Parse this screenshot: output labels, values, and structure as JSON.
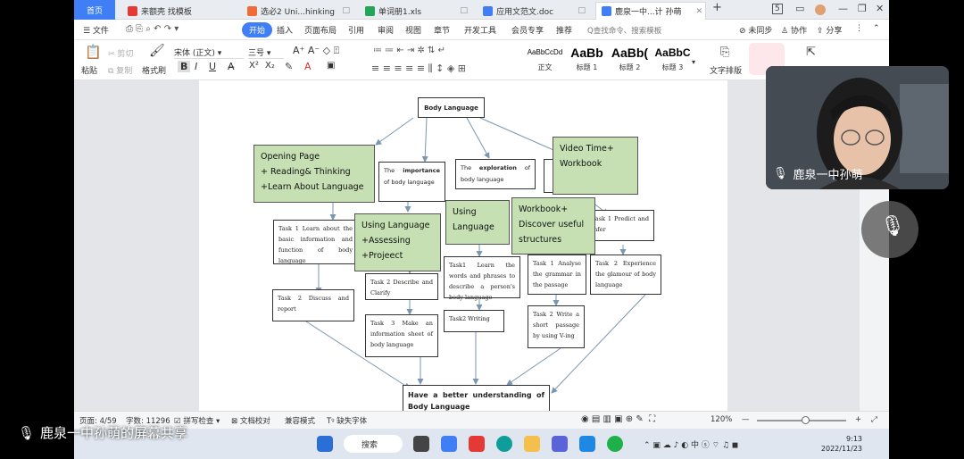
{
  "tabs": [
    {
      "label": "首页",
      "type": "home"
    },
    {
      "label": "来额壳 找模板",
      "color": "#e53935"
    },
    {
      "label": "选必2 Uni...hinking",
      "color": "#ef6c3a"
    },
    {
      "label": "单词册1.xls",
      "color": "#23a55a"
    },
    {
      "label": "应用文范文.doc",
      "color": "#3f7ef5"
    },
    {
      "label": "鹿泉一中...计 孙萌",
      "color": "#3f7ef5",
      "active": true
    }
  ],
  "window_controls": {
    "num": "5",
    "min": "—",
    "restore": "❐",
    "close": "✕"
  },
  "menu": {
    "file": "☰ 文件",
    "items": [
      "开始",
      "插入",
      "页面布局",
      "引用",
      "审阅",
      "视图",
      "章节",
      "开发工具",
      "会员专享",
      "推荐"
    ],
    "search_placeholder": "Q查找命令、搜索模板",
    "unsynced": "未同步",
    "collab": "协作",
    "share": "分享"
  },
  "ribbon": {
    "paste": "粘贴",
    "cut": "剪切",
    "copy": "复制",
    "format_painter": "格式刷",
    "font_name": "宋体 (正文)",
    "font_size": "三号",
    "styles": [
      {
        "preview": "AaBbCcDd",
        "label": "正文"
      },
      {
        "preview": "AaBb",
        "label": "标题 1"
      },
      {
        "preview": "AaBb(",
        "label": "标题 2"
      },
      {
        "preview": "AaBbC",
        "label": "标题 3"
      }
    ],
    "text_layout": "文字排版"
  },
  "diagram": {
    "root": "Body Language",
    "importance_pre": "The ",
    "importance_bold": "importance",
    "importance_post": " of body language",
    "exploration_pre": "The ",
    "exploration_bold": "exploration",
    "exploration_post": " of body language",
    "opening": "Opening Page\n+ Reading& Thinking\n+Learn About Language",
    "video": "Video Time+\nWorkbook",
    "using_assessing": "Using Language\n+Assessing\n+Projeect",
    "using_language": "Using\nLanguage",
    "workbook": "Workbook+\nDiscover useful\nstructures",
    "task1_learn_about": "Task 1 Learn about the basic information and function of body language",
    "task2_discuss": "Task 2 Discuss and report",
    "task2_describe": "Task 2 Describe and Clarify",
    "task3_make": "Task 3 Make an information sheet of body language",
    "task1_learn_words": "Task1 Learn the words and phrases to describe a person's body language",
    "task2_writing": "Task2 Writing",
    "task1_analyse": "Task 1 Analyse the grammar in the passage",
    "task2_write": "Task 2 Write a short passage by using V-ing",
    "task1_predict": "Task 1 Predict and infer",
    "task2_experience": "Task 2 Experience the glamour of body language",
    "final": "Have a better understanding of Body Language"
  },
  "status": {
    "page": "页面: 4/59",
    "words": "字数: 11296",
    "spellcheck": "拼写检查 ▾",
    "doc_check": "文档校对",
    "compat": "兼容模式",
    "missing_font": "缺失字体",
    "zoom": "120%"
  },
  "taskbar": {
    "search": "搜索",
    "time": "9:13",
    "date": "2022/11/23"
  },
  "video": {
    "name": "鹿泉一中孙萌"
  },
  "share_label": "鹿泉一中孙萌的屏幕共享"
}
